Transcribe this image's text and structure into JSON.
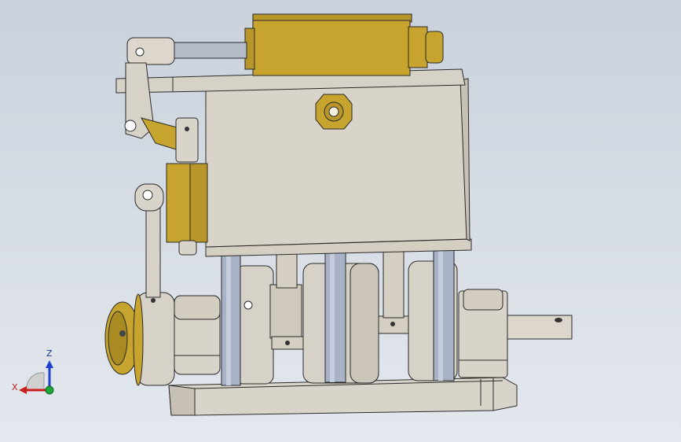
{
  "viewport": {
    "background_top": "#c9d1db",
    "background_bottom": "#e4e8ee"
  },
  "model": {
    "part_colors": {
      "aluminum": "#d7d2c8",
      "aluminum_shadow": "#b9b3a8",
      "brass": "#c7a42e",
      "brass_dark": "#8f7418",
      "steel_rod": "#a9b3c7",
      "outline": "#2a2a2a"
    }
  },
  "triad": {
    "z_label": "Z",
    "x_label": "X",
    "z_color": "#1f3fd1",
    "x_color": "#c81e1e",
    "y_color": "#1fa83a"
  }
}
